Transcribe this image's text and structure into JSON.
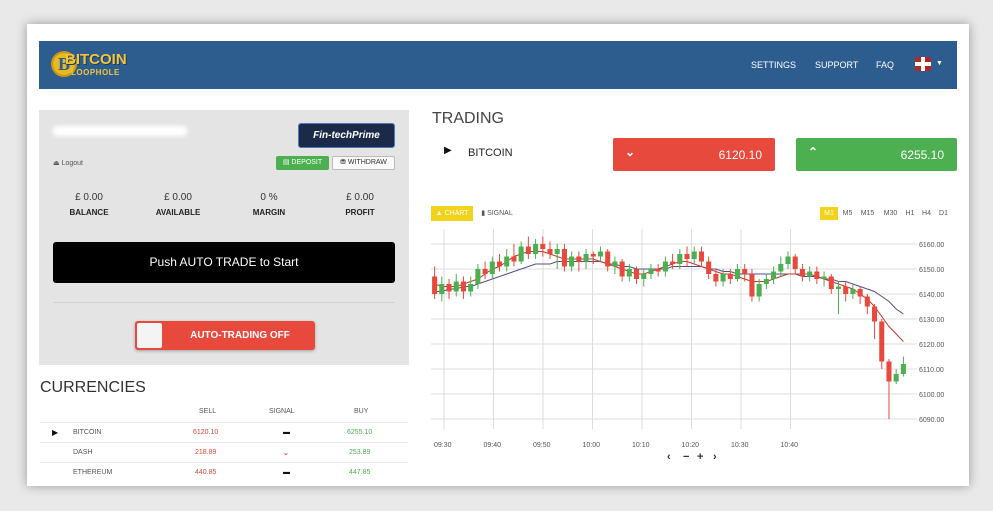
{
  "header": {
    "logo_main": "BITCOIN",
    "logo_sub": "LOOPHOLE",
    "logo_glyph": "B",
    "nav": [
      "SETTINGS",
      "SUPPORT",
      "FAQ"
    ],
    "language_icon": "uk-flag-icon"
  },
  "account": {
    "partner_badge": "Fin-techPrime",
    "logout_label": "Logout",
    "deposit_label": "DEPOSIT",
    "withdraw_label": "WITHDRAW",
    "stats": [
      {
        "value": "£ 0.00",
        "label": "BALANCE"
      },
      {
        "value": "£ 0.00",
        "label": "AVAILABLE"
      },
      {
        "value": "0 %",
        "label": "MARGIN"
      },
      {
        "value": "£ 0.00",
        "label": "PROFIT"
      }
    ],
    "push_button": "Push AUTO TRADE to Start",
    "auto_trading_label": "AUTO-TRADING OFF"
  },
  "currencies": {
    "title": "CURRENCIES",
    "headers": {
      "sell": "SELL",
      "signal": "SIGNAL",
      "buy": "BUY"
    },
    "rows": [
      {
        "name": "BITCOIN",
        "sell": "6120.10",
        "signal": "neutral",
        "buy": "6255.10",
        "selected": true
      },
      {
        "name": "DASH",
        "sell": "218.89",
        "signal": "down",
        "buy": "253.89",
        "selected": false
      },
      {
        "name": "ETHEREUM",
        "sell": "440.85",
        "signal": "neutral",
        "buy": "447.85",
        "selected": false
      }
    ]
  },
  "trading": {
    "title": "TRADING",
    "instrument": "BITCOIN",
    "sell_price": "6120.10",
    "buy_price": "6255.10",
    "chart_tab": "CHART",
    "signal_tab": "SIGNAL",
    "timeframes": [
      "M1",
      "M5",
      "M15",
      "M30",
      "H1",
      "H4",
      "D1"
    ],
    "active_timeframe": "M1",
    "nav_controls": [
      "‹",
      "−",
      "+",
      "›"
    ]
  },
  "colors": {
    "header_bg": "#2d5d8f",
    "sell": "#e8493d",
    "buy": "#4caf50",
    "active_tab": "#f2d21b"
  },
  "chart_data": {
    "type": "candlestick",
    "x_ticks": [
      "09:30",
      "09:40",
      "09:50",
      "10:00",
      "10:10",
      "10:20",
      "10:30",
      "10:40"
    ],
    "y_ticks": [
      "6160.00",
      "6150.00",
      "6140.00",
      "6130.00",
      "6120.00",
      "6110.00",
      "6100.00",
      "6090.00"
    ],
    "ylim": [
      6086,
      6166
    ],
    "candles": [
      [
        6147,
        6140,
        6151,
        6138
      ],
      [
        6140,
        6144,
        6147,
        6137
      ],
      [
        6144,
        6141,
        6146,
        6138
      ],
      [
        6141,
        6145,
        6148,
        6139
      ],
      [
        6145,
        6141,
        6147,
        6138
      ],
      [
        6141,
        6144,
        6147,
        6139
      ],
      [
        6144,
        6150,
        6152,
        6142
      ],
      [
        6150,
        6148,
        6153,
        6146
      ],
      [
        6148,
        6153,
        6155,
        6146
      ],
      [
        6153,
        6151,
        6156,
        6149
      ],
      [
        6151,
        6155,
        6158,
        6149
      ],
      [
        6155,
        6153,
        6160,
        6151
      ],
      [
        6153,
        6159,
        6161,
        6152
      ],
      [
        6159,
        6156,
        6163,
        6154
      ],
      [
        6156,
        6160,
        6162,
        6154
      ],
      [
        6160,
        6158,
        6163,
        6155
      ],
      [
        6158,
        6156,
        6161,
        6154
      ],
      [
        6156,
        6158,
        6160,
        6150
      ],
      [
        6158,
        6151,
        6160,
        6149
      ],
      [
        6151,
        6155,
        6157,
        6149
      ],
      [
        6155,
        6153,
        6157,
        6149
      ],
      [
        6153,
        6156,
        6158,
        6150
      ],
      [
        6156,
        6155,
        6157,
        6152
      ],
      [
        6155,
        6157,
        6159,
        6153
      ],
      [
        6157,
        6151,
        6158,
        6149
      ],
      [
        6151,
        6153,
        6155,
        6148
      ],
      [
        6153,
        6147,
        6154,
        6145
      ],
      [
        6147,
        6150,
        6152,
        6145
      ],
      [
        6150,
        6146,
        6151,
        6144
      ],
      [
        6146,
        6148,
        6150,
        6143
      ],
      [
        6148,
        6150,
        6152,
        6146
      ],
      [
        6150,
        6149,
        6152,
        6147
      ],
      [
        6149,
        6153,
        6155,
        6147
      ],
      [
        6153,
        6152,
        6156,
        6150
      ],
      [
        6152,
        6156,
        6158,
        6150
      ],
      [
        6156,
        6154,
        6159,
        6151
      ],
      [
        6154,
        6157,
        6159,
        6152
      ],
      [
        6157,
        6153,
        6159,
        6151
      ],
      [
        6153,
        6148,
        6155,
        6146
      ],
      [
        6148,
        6145,
        6150,
        6143
      ],
      [
        6145,
        6148,
        6150,
        6143
      ],
      [
        6148,
        6146,
        6150,
        6144
      ],
      [
        6146,
        6150,
        6152,
        6145
      ],
      [
        6150,
        6148,
        6152,
        6145
      ],
      [
        6148,
        6139,
        6150,
        6137
      ],
      [
        6139,
        6144,
        6146,
        6137
      ],
      [
        6144,
        6146,
        6148,
        6142
      ],
      [
        6146,
        6149,
        6151,
        6144
      ],
      [
        6149,
        6152,
        6155,
        6147
      ],
      [
        6152,
        6155,
        6157,
        6150
      ],
      [
        6155,
        6150,
        6156,
        6148
      ],
      [
        6150,
        6147,
        6152,
        6145
      ],
      [
        6147,
        6149,
        6151,
        6145
      ],
      [
        6149,
        6146,
        6151,
        6144
      ],
      [
        6146,
        6147,
        6149,
        6143
      ],
      [
        6147,
        6142,
        6148,
        6140
      ],
      [
        6142,
        6143,
        6145,
        6132
      ],
      [
        6143,
        6140,
        6145,
        6137
      ],
      [
        6140,
        6142,
        6144,
        6138
      ],
      [
        6142,
        6139,
        6143,
        6136
      ],
      [
        6139,
        6135,
        6140,
        6132
      ],
      [
        6135,
        6129,
        6136,
        6122
      ],
      [
        6129,
        6113,
        6130,
        6110
      ],
      [
        6113,
        6105,
        6114,
        6090
      ],
      [
        6105,
        6108,
        6110,
        6104
      ],
      [
        6108,
        6112,
        6115,
        6107
      ]
    ],
    "ma_fast": [
      6144,
      6143,
      6143,
      6143,
      6144,
      6145,
      6146,
      6148,
      6150,
      6151,
      6153,
      6155,
      6156,
      6157,
      6157,
      6157,
      6156,
      6155,
      6154,
      6154,
      6154,
      6154,
      6154,
      6153,
      6152,
      6151,
      6150,
      6149,
      6148,
      6148,
      6149,
      6150,
      6151,
      6152,
      6153,
      6153,
      6152,
      6151,
      6150,
      6149,
      6148,
      6148,
      6147,
      6146,
      6145,
      6145,
      6145,
      6146,
      6147,
      6148,
      6148,
      6148,
      6148,
      6147,
      6146,
      6145,
      6144,
      6143,
      6142,
      6140,
      6138,
      6135,
      6131,
      6127,
      6124,
      6121
    ],
    "ma_slow": [
      6141,
      6141,
      6142,
      6142,
      6143,
      6143,
      6144,
      6145,
      6146,
      6147,
      6148,
      6149,
      6150,
      6151,
      6152,
      6152,
      6152,
      6153,
      6153,
      6153,
      6153,
      6153,
      6153,
      6153,
      6152,
      6152,
      6151,
      6151,
      6150,
      6150,
      6150,
      6150,
      6150,
      6151,
      6151,
      6151,
      6151,
      6151,
      6150,
      6150,
      6149,
      6149,
      6148,
      6148,
      6148,
      6148,
      6148,
      6148,
      6148,
      6148,
      6148,
      6147,
      6147,
      6147,
      6146,
      6146,
      6145,
      6145,
      6144,
      6143,
      6142,
      6141,
      6139,
      6137,
      6134,
      6132
    ]
  }
}
